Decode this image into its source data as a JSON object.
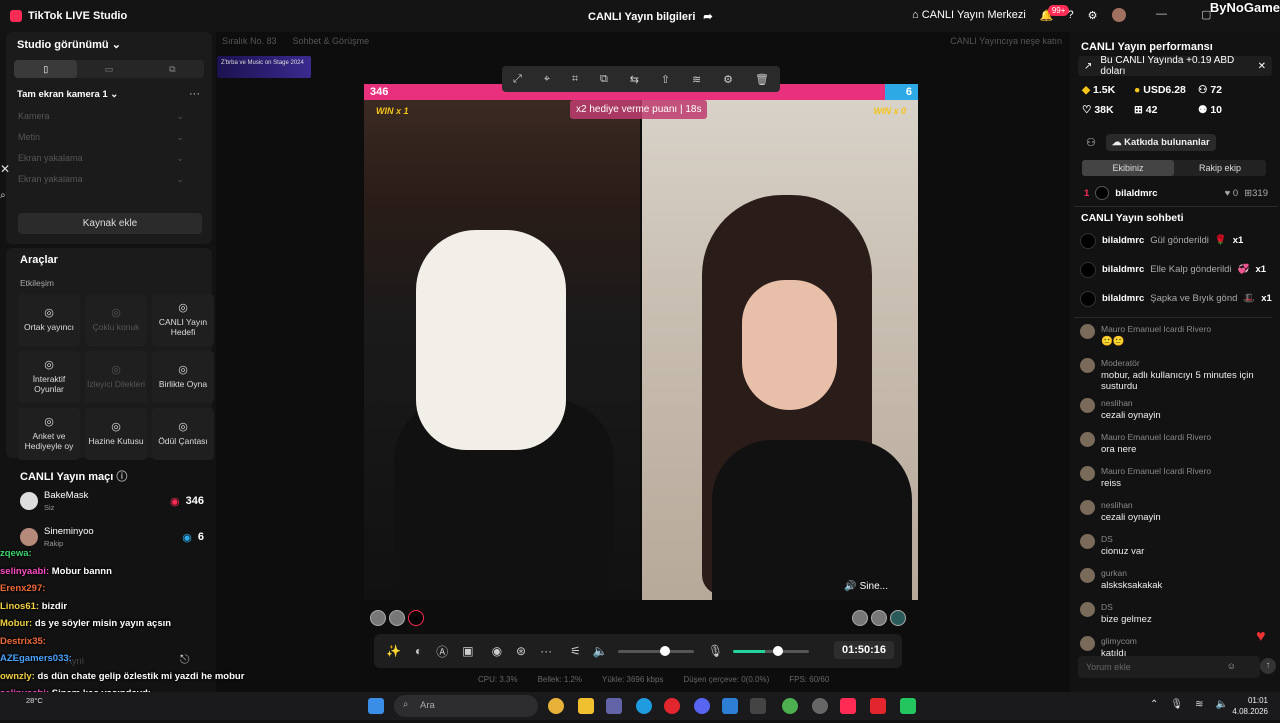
{
  "titlebar": {
    "app_name": "TikTok LIVE Studio",
    "center_title": "CANLI Yayın bilgileri",
    "center_share_icon": "share-icon",
    "live_center": "CANLI Yayın Merkezi",
    "notif_count": "99+",
    "watermark": "ByNoGame"
  },
  "left": {
    "studio_view": "Studio görünümü",
    "scene": "Tam ekran kamera 1",
    "sources": [
      "Kamera",
      "Metin",
      "Ekran yakalama",
      "Ekran yakalama"
    ],
    "add_source": "Kaynak ekle",
    "tools_title": "Araçlar",
    "interaction_label": "Etkileşim",
    "tools": [
      {
        "label": "Ortak yayıncı",
        "icon": "link-icon",
        "dim": false
      },
      {
        "label": "Çoklu konuk",
        "icon": "users-icon",
        "dim": true
      },
      {
        "label": "CANLI Yayın Hedefi",
        "icon": "target-icon",
        "dim": false
      },
      {
        "label": "İnteraktif Oyunlar",
        "icon": "gamepad-icon",
        "dim": false
      },
      {
        "label": "İzleyici Dilekleri",
        "icon": "gift-icon",
        "dim": true
      },
      {
        "label": "Birlikte Oyna",
        "icon": "play-together-icon",
        "dim": false
      },
      {
        "label": "Anket ve Hediyeyle oy",
        "icon": "poll-icon",
        "dim": false
      },
      {
        "label": "Hazine Kutusu",
        "icon": "treasure-icon",
        "dim": false
      },
      {
        "label": "Ödül Çantası",
        "icon": "bag-icon",
        "dim": false
      }
    ],
    "match_title": "CANLI Yayın maçı",
    "players": [
      {
        "name": "BakeMask",
        "role": "Siz",
        "score": "346"
      },
      {
        "name": "Sineminyoo",
        "role": "Rakip",
        "score": "6"
      }
    ],
    "leave_label": "Ayrıl"
  },
  "overlay_chat": [
    {
      "user": "zqewa:",
      "text": "",
      "cls": "g"
    },
    {
      "user": "selinyaabi:",
      "text": "Mobur bannn",
      "cls": "p"
    },
    {
      "user": "Erenx297:",
      "text": "",
      "cls": ""
    },
    {
      "user": "Linos61:",
      "text": "bizdir",
      "cls": "y"
    },
    {
      "user": "Mobur:",
      "text": "ds ye söyler misin yayın açsın",
      "cls": "y"
    },
    {
      "user": "Destrix35:",
      "text": "",
      "cls": ""
    },
    {
      "user": "AZEgamers033:",
      "text": "",
      "cls": "b"
    },
    {
      "user": "ownzly:",
      "text": "ds dün chate gelip özlestik mi yazdi he mobur",
      "cls": "y"
    },
    {
      "user": "selinyaabi:",
      "text": "Sinem kaç yaşındaydı",
      "cls": "p"
    },
    {
      "user": "zqewa:",
      "text": "",
      "cls": "g"
    }
  ],
  "center": {
    "top_items": [
      "Sıralık No. 83",
      "Sohbet & Görüşme"
    ],
    "top_right": "CANLI Yayıncıya neşe katın",
    "banner": "Z'brba ve Music on Stage 2024",
    "score_left": "346",
    "score_right": "6",
    "win_left": "WIN x 1",
    "win_right": "WIN x 0",
    "gift_bonus": "x2 hediye verme puanı",
    "gift_timer": "18s",
    "opponent_tag": "Sine...",
    "timer": "01:50:16",
    "stats": [
      "CPU: 3.3%",
      "Bellek: 1.2%",
      "Yükle: 3696 kbps",
      "Düşen çerçeve: 0(0.0%)",
      "FPS: 60/60"
    ]
  },
  "right": {
    "perf_title": "CANLI Yayın performansı",
    "earn_text": "Bu CANLI Yayında +0.19 ABD doları",
    "metrics": [
      {
        "icon": "diamond-icon",
        "value": "1.5K"
      },
      {
        "icon": "coin-icon",
        "value": "USD6.28"
      },
      {
        "icon": "viewers-icon",
        "value": "72"
      },
      {
        "icon": "followers-icon",
        "value": "10"
      },
      {
        "icon": "heart-icon",
        "value": "38K"
      },
      {
        "icon": "gift-icon",
        "value": "42"
      }
    ],
    "contrib_label": "Katkıda bulunanlar",
    "tab_our": "Ekibiniz",
    "tab_rival": "Rakip ekip",
    "rank": {
      "pos": "1",
      "name": "bilaldmrc",
      "likes": "0",
      "gifts": "319"
    },
    "chat_title": "CANLI Yayın sohbeti",
    "gift_rows": [
      {
        "user": "bilaldmrc",
        "text": "Gül gönderildi",
        "count": "x1"
      },
      {
        "user": "bilaldmrc",
        "text": "Elle Kalp gönderildi",
        "count": "x1"
      },
      {
        "user": "bilaldmrc",
        "text": "Şapka ve Bıyık gönd",
        "count": "x1"
      }
    ],
    "messages": [
      {
        "user": "Mauro Emanuel Icardi Rivero",
        "text": "🙂🙂"
      },
      {
        "user": "Moderatör",
        "text": "mobur, adlı kullanıcıyı 5 minutes için susturdu"
      },
      {
        "user": "neslihan",
        "text": "cezali oynayin"
      },
      {
        "user": "Mauro Emanuel Icardi Rivero",
        "text": "ora nere"
      },
      {
        "user": "Mauro Emanuel Icardi Rivero",
        "text": "reiss"
      },
      {
        "user": "neslihan",
        "text": "cezali oynayin"
      },
      {
        "user": "DS",
        "text": "cionuz var"
      },
      {
        "user": "gurkan",
        "text": "alsksksakakak"
      },
      {
        "user": "DS",
        "text": "bize gelmez"
      },
      {
        "user": "glimycom",
        "text": "katıldı"
      }
    ],
    "input_placeholder": "Yorum ekle"
  },
  "taskbar": {
    "search": "Ara",
    "temp": "28°C",
    "time": "01:01",
    "date": "4.08.2026"
  },
  "colors": {
    "accent": "#fe2c55",
    "blue": "#2da9e6"
  }
}
